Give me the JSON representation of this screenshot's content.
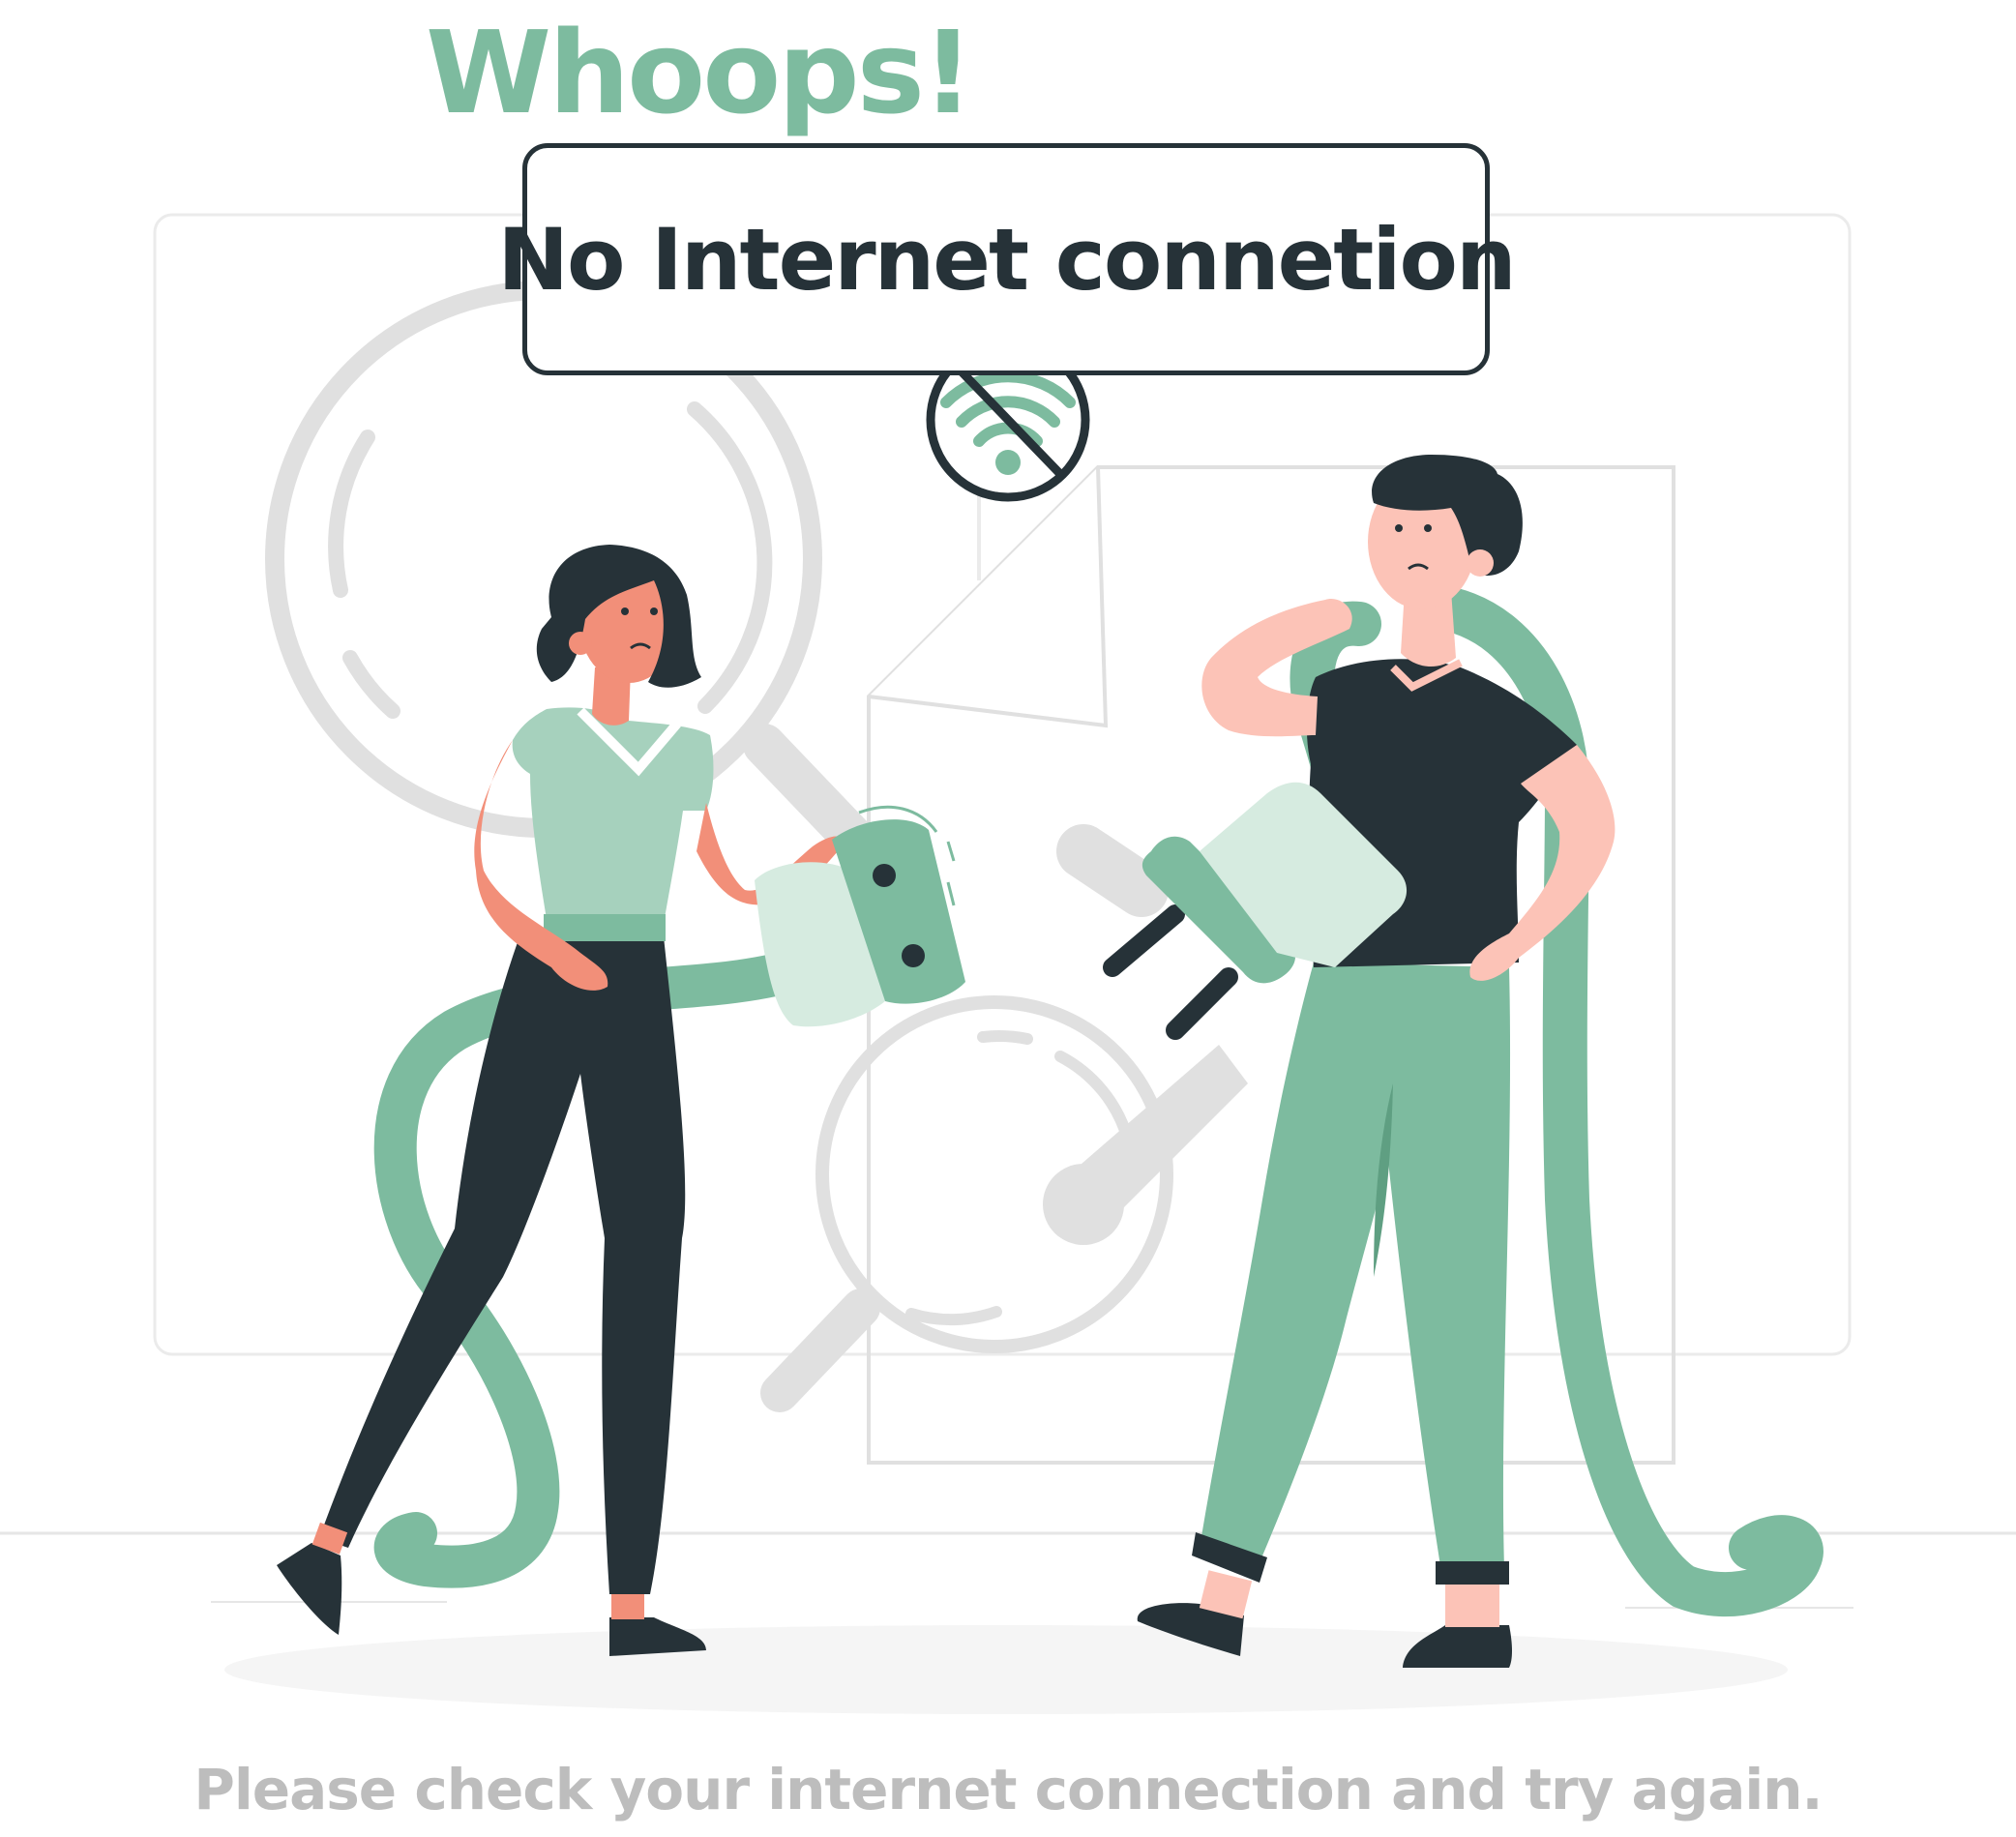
{
  "title": "Whoops!",
  "notice": "No Internet connetion",
  "message": "Please check your internet connection and try again.",
  "colors": {
    "accent": "#7dbb9f",
    "accent_light": "#a6d1bd",
    "accent_pale": "#d6ebe0",
    "dark": "#263238",
    "skin": "#f28f79",
    "skin_light": "#fcc3b7",
    "gray_bg": "#e0e0e0",
    "footer_text": "#bdbdbd"
  },
  "icons": {
    "status": "no-wifi-icon",
    "background": "magnifier-icon"
  }
}
